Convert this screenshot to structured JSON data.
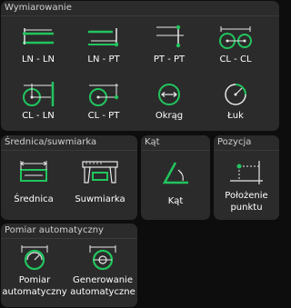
{
  "sections": {
    "wymiarowanie": {
      "title": "Wymiarowanie",
      "tools": [
        {
          "label": "LN - LN",
          "icon": "line-to-line-icon"
        },
        {
          "label": "LN - PT",
          "icon": "line-to-point-icon"
        },
        {
          "label": "PT - PT",
          "icon": "point-to-point-icon"
        },
        {
          "label": "CL - CL",
          "icon": "circle-to-circle-icon"
        },
        {
          "label": "CL - LN",
          "icon": "circle-to-line-icon"
        },
        {
          "label": "CL - PT",
          "icon": "circle-to-point-icon"
        },
        {
          "label": "Okrąg",
          "icon": "circle-icon"
        },
        {
          "label": "Łuk",
          "icon": "arc-icon"
        }
      ]
    },
    "srednica": {
      "title": "Średnica/suwmiarka",
      "tools": [
        {
          "label": "Średnica",
          "icon": "diameter-icon"
        },
        {
          "label": "Suwmiarka",
          "icon": "caliper-icon"
        }
      ]
    },
    "kat": {
      "title": "Kąt",
      "tools": [
        {
          "label": "Kąt",
          "icon": "angle-icon"
        }
      ]
    },
    "pozycja": {
      "title": "Pozycja",
      "tools": [
        {
          "label_line1": "Położenie",
          "label_line2": "punktu",
          "icon": "point-position-icon"
        }
      ]
    },
    "pomiar": {
      "title": "Pomiar automatyczny",
      "tools": [
        {
          "label_line1": "Pomiar",
          "label_line2": "automatyczny",
          "icon": "auto-measure-icon"
        },
        {
          "label_line1": "Generowanie",
          "label_line2": "automatyczne",
          "icon": "auto-generate-icon"
        }
      ]
    }
  },
  "colors": {
    "accent": "#22c55e",
    "icon_line": "#e8e8e8",
    "panel_bg": "#2b2b2b",
    "page_bg": "#0d0d0d"
  }
}
